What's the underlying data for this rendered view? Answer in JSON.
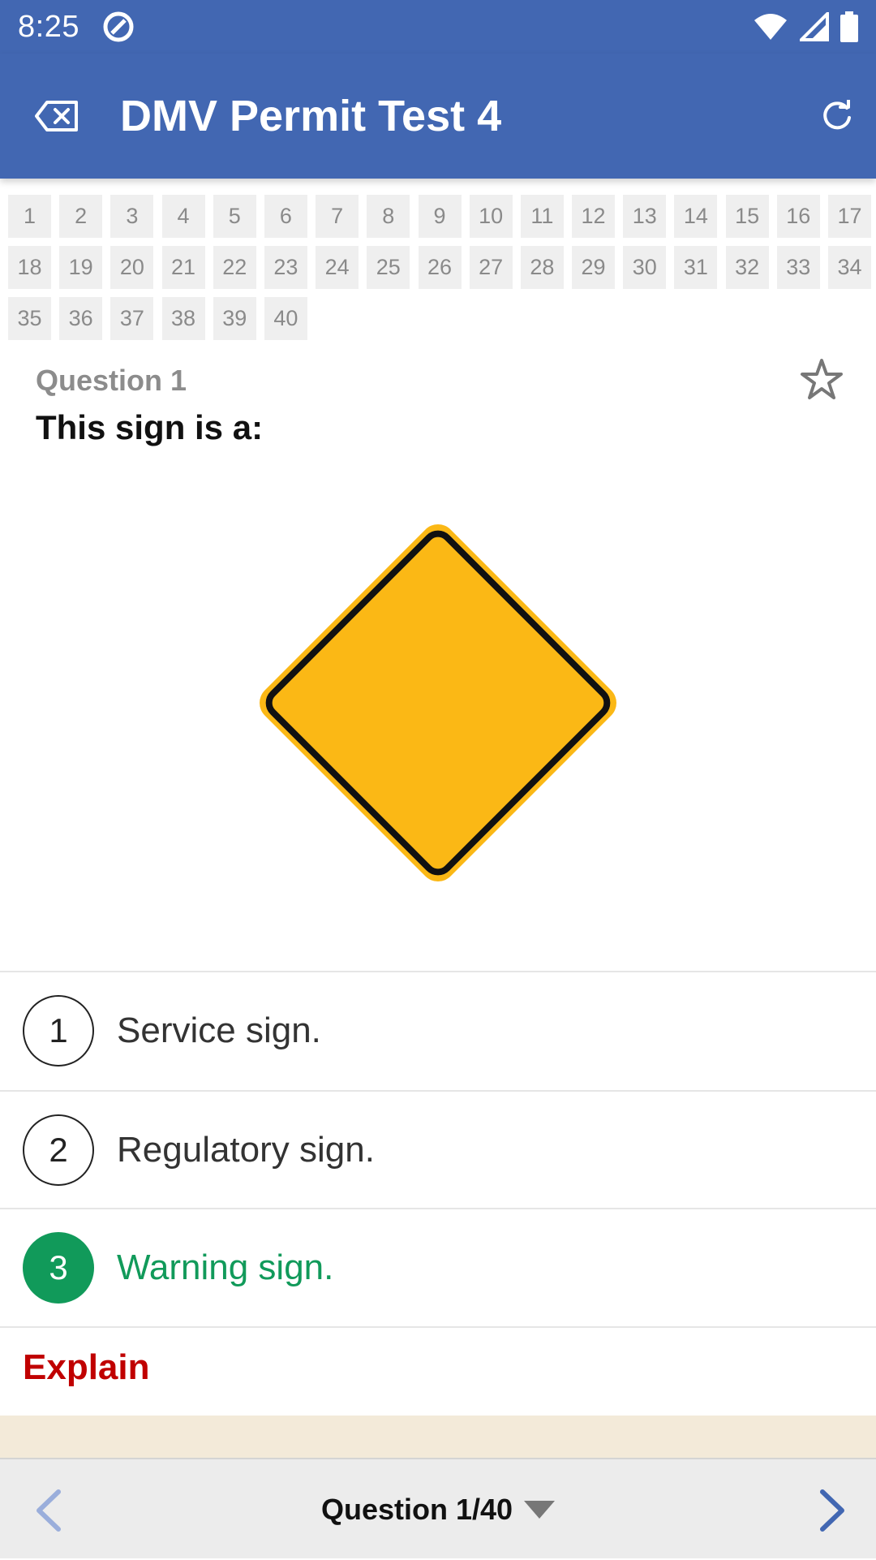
{
  "status_bar": {
    "time": "8:25",
    "icons": [
      "app-notification-icon",
      "wifi-icon",
      "signal-icon",
      "battery-icon"
    ]
  },
  "app_bar": {
    "title": "DMV Permit Test 4",
    "back_icon": "backspace-icon",
    "refresh_icon": "refresh-icon",
    "color": "#4267b2"
  },
  "question_grid": {
    "rows": [
      [
        "1",
        "2",
        "3",
        "4",
        "5",
        "6",
        "7",
        "8",
        "9",
        "10",
        "11",
        "12",
        "13",
        "14",
        "15",
        "16",
        "17"
      ],
      [
        "18",
        "19",
        "20",
        "21",
        "22",
        "23",
        "24",
        "25",
        "26",
        "27",
        "28",
        "29",
        "30",
        "31",
        "32",
        "33",
        "34"
      ],
      [
        "35",
        "36",
        "37",
        "38",
        "39",
        "40"
      ]
    ]
  },
  "question": {
    "label": "Question 1",
    "text": "This sign is a:",
    "sign_color": "#fbb815"
  },
  "answers": [
    {
      "num": "1",
      "text": "Service sign.",
      "correct": false
    },
    {
      "num": "2",
      "text": "Regulatory sign.",
      "correct": false
    },
    {
      "num": "3",
      "text": "Warning sign.",
      "correct": true
    }
  ],
  "explain": {
    "label": "Explain",
    "color": "#c00000"
  },
  "bottom_nav": {
    "label": "Question 1/40",
    "prev_icon": "chevron-left-icon",
    "next_icon": "chevron-right-icon",
    "dropdown_icon": "triangle-down-icon"
  },
  "colors": {
    "correct": "#119a5a",
    "primary": "#4267b2"
  }
}
